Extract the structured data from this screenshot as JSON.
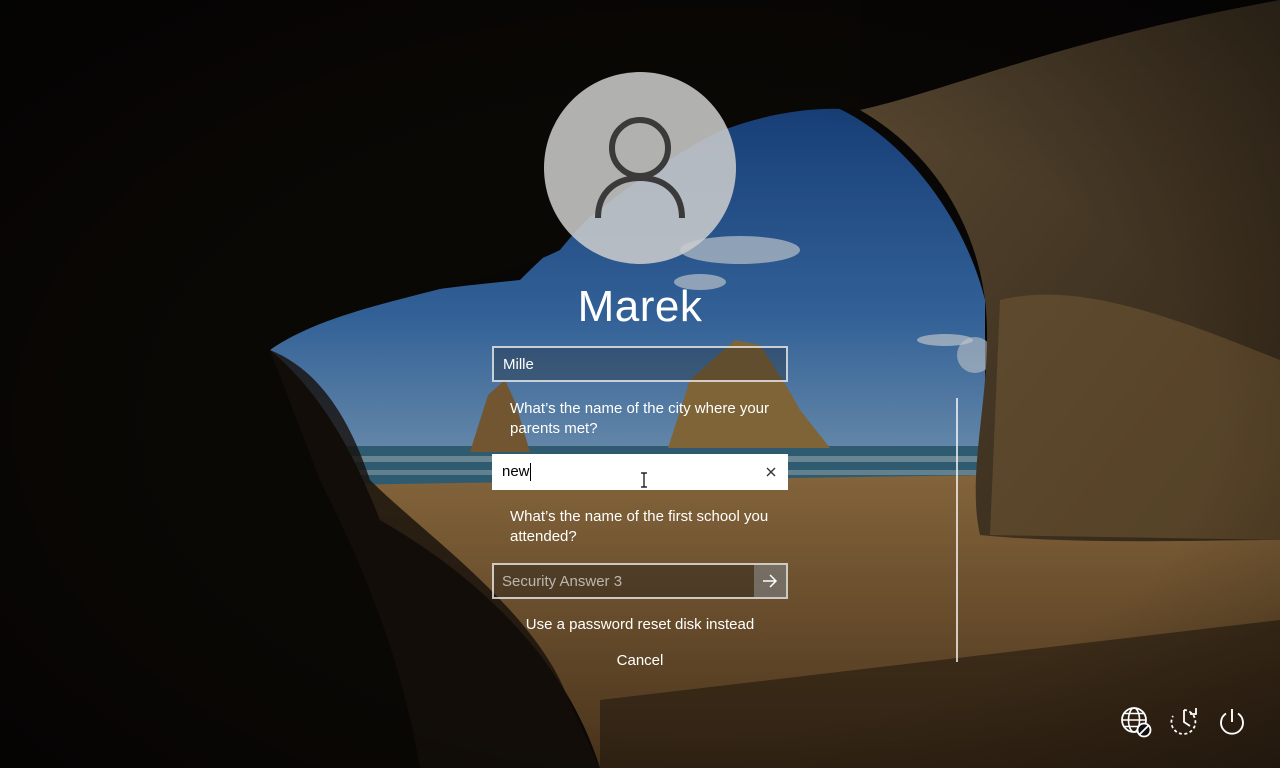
{
  "user": {
    "name": "Marek"
  },
  "security_questions": {
    "answer1_value": "Mille",
    "question2": "What’s the name of the city where your parents met?",
    "answer2_value": "new",
    "question3": "What’s the name of the first school you attended?",
    "answer3_placeholder": "Security Answer 3"
  },
  "actions": {
    "reset_disk_label": "Use a password reset disk instead",
    "cancel_label": "Cancel"
  },
  "system_icons": [
    "network-icon",
    "ease-of-access-icon",
    "power-icon"
  ],
  "colors": {
    "text": "#ffffff",
    "field_border": "#ffffff",
    "active_field_bg": "#ffffff"
  }
}
